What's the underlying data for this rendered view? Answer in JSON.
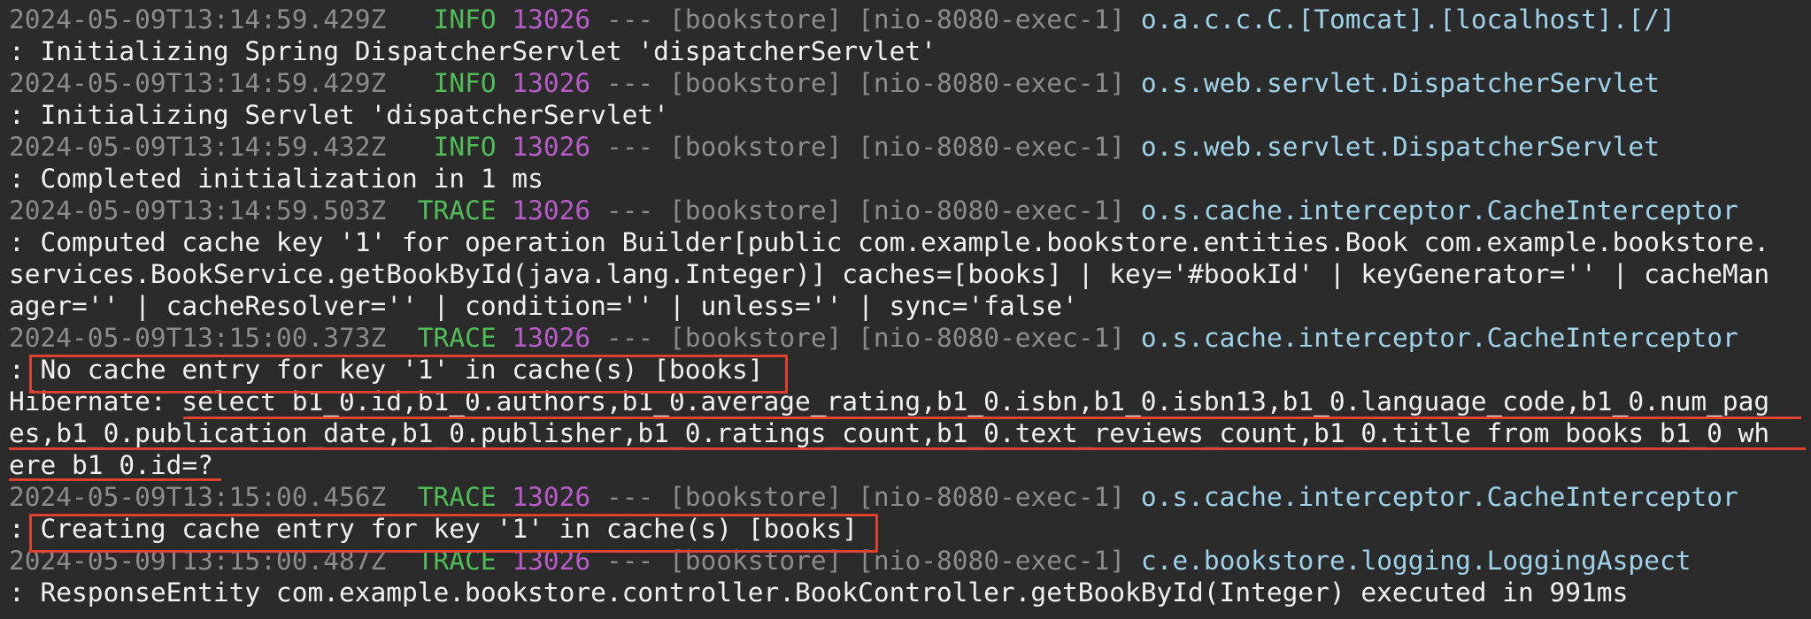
{
  "log": [
    {
      "kind": "header",
      "timestamp": "2024-05-09T13:14:59.429Z",
      "level": " INFO",
      "pid": "13026",
      "sep": "---",
      "app": "[bookstore]",
      "thread": "[nio-8080-exec-1]",
      "logger": "o.a.c.c.C.[Tomcat].[localhost].[/]"
    },
    {
      "kind": "message",
      "text": ": Initializing Spring DispatcherServlet 'dispatcherServlet'"
    },
    {
      "kind": "header",
      "timestamp": "2024-05-09T13:14:59.429Z",
      "level": " INFO",
      "pid": "13026",
      "sep": "---",
      "app": "[bookstore]",
      "thread": "[nio-8080-exec-1]",
      "logger": "o.s.web.servlet.DispatcherServlet"
    },
    {
      "kind": "message",
      "text": ": Initializing Servlet 'dispatcherServlet'"
    },
    {
      "kind": "header",
      "timestamp": "2024-05-09T13:14:59.432Z",
      "level": " INFO",
      "pid": "13026",
      "sep": "---",
      "app": "[bookstore]",
      "thread": "[nio-8080-exec-1]",
      "logger": "o.s.web.servlet.DispatcherServlet"
    },
    {
      "kind": "message",
      "text": ": Completed initialization in 1 ms"
    },
    {
      "kind": "header",
      "timestamp": "2024-05-09T13:14:59.503Z",
      "level": "TRACE",
      "pid": "13026",
      "sep": "---",
      "app": "[bookstore]",
      "thread": "[nio-8080-exec-1]",
      "logger": "o.s.cache.interceptor.CacheInterceptor"
    },
    {
      "kind": "message",
      "text": ": Computed cache key '1' for operation Builder[public com.example.bookstore.entities.Book com.example.bookstore."
    },
    {
      "kind": "message",
      "text": "services.BookService.getBookById(java.lang.Integer)] caches=[books] | key='#bookId' | keyGenerator='' | cacheMan"
    },
    {
      "kind": "message",
      "text": "ager='' | cacheResolver='' | condition='' | unless='' | sync='false'"
    },
    {
      "kind": "header",
      "timestamp": "2024-05-09T13:15:00.373Z",
      "level": "TRACE",
      "pid": "13026",
      "sep": "---",
      "app": "[bookstore]",
      "thread": "[nio-8080-exec-1]",
      "logger": "o.s.cache.interceptor.CacheInterceptor"
    },
    {
      "kind": "message",
      "text": ": No cache entry for key '1' in cache(s) [books]"
    },
    {
      "kind": "message",
      "text": "Hibernate: select b1_0.id,b1_0.authors,b1_0.average_rating,b1_0.isbn,b1_0.isbn13,b1_0.language_code,b1_0.num_pag"
    },
    {
      "kind": "message",
      "text": "es,b1_0.publication_date,b1_0.publisher,b1_0.ratings_count,b1_0.text_reviews_count,b1_0.title from books b1_0 wh"
    },
    {
      "kind": "message",
      "text": "ere b1_0.id=?"
    },
    {
      "kind": "header",
      "timestamp": "2024-05-09T13:15:00.456Z",
      "level": "TRACE",
      "pid": "13026",
      "sep": "---",
      "app": "[bookstore]",
      "thread": "[nio-8080-exec-1]",
      "logger": "o.s.cache.interceptor.CacheInterceptor"
    },
    {
      "kind": "message",
      "text": ": Creating cache entry for key '1' in cache(s) [books]"
    },
    {
      "kind": "header",
      "timestamp": "2024-05-09T13:15:00.487Z",
      "level": "TRACE",
      "pid": "13026",
      "sep": "---",
      "app": "[bookstore]",
      "thread": "[nio-8080-exec-1]",
      "logger": "c.e.bookstore.logging.LoggingAspect"
    },
    {
      "kind": "message",
      "text": ": ResponseEntity com.example.bookstore.controller.BookController.getBookById(Integer) executed in 991ms"
    }
  ],
  "colors": {
    "background": "#2b2b2b",
    "timestamp": "#8c8c8c",
    "level": "#4fbd58",
    "pid": "#b85cc8",
    "logger": "#9fd3ea",
    "message": "#f2f2f2",
    "highlight": "#e0402e"
  }
}
